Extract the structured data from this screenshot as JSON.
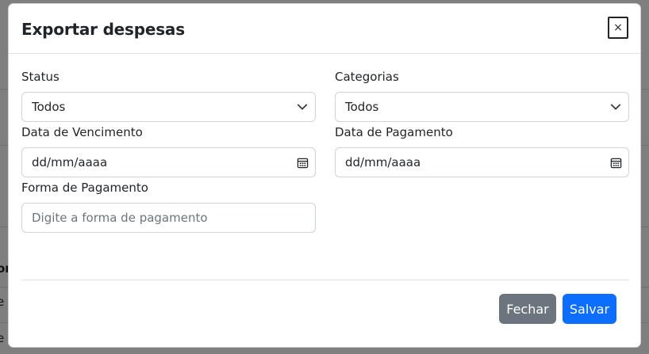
{
  "background": {
    "fragments": [
      "or",
      "e",
      "e"
    ]
  },
  "modal": {
    "title": "Exportar despesas",
    "close_label": "×",
    "status": {
      "label": "Status",
      "value": "Todos"
    },
    "categorias": {
      "label": "Categorias",
      "value": "Todos"
    },
    "data_vencimento": {
      "label": "Data de Vencimento",
      "value": "dd/mm/aaaa"
    },
    "data_pagamento": {
      "label": "Data de Pagamento",
      "value": "dd/mm/aaaa"
    },
    "forma_pagamento": {
      "label": "Forma de Pagamento",
      "placeholder": "Digite a forma de pagamento"
    },
    "footer": {
      "close_label": "Fechar",
      "save_label": "Salvar"
    }
  },
  "colors": {
    "primary": "#0d6efd",
    "secondary": "#6c757d",
    "overlay": "rgba(0,0,0,0.5)"
  },
  "icons": {
    "select_chevron": "chevron-down-icon",
    "date_picker": "calendar-icon"
  }
}
